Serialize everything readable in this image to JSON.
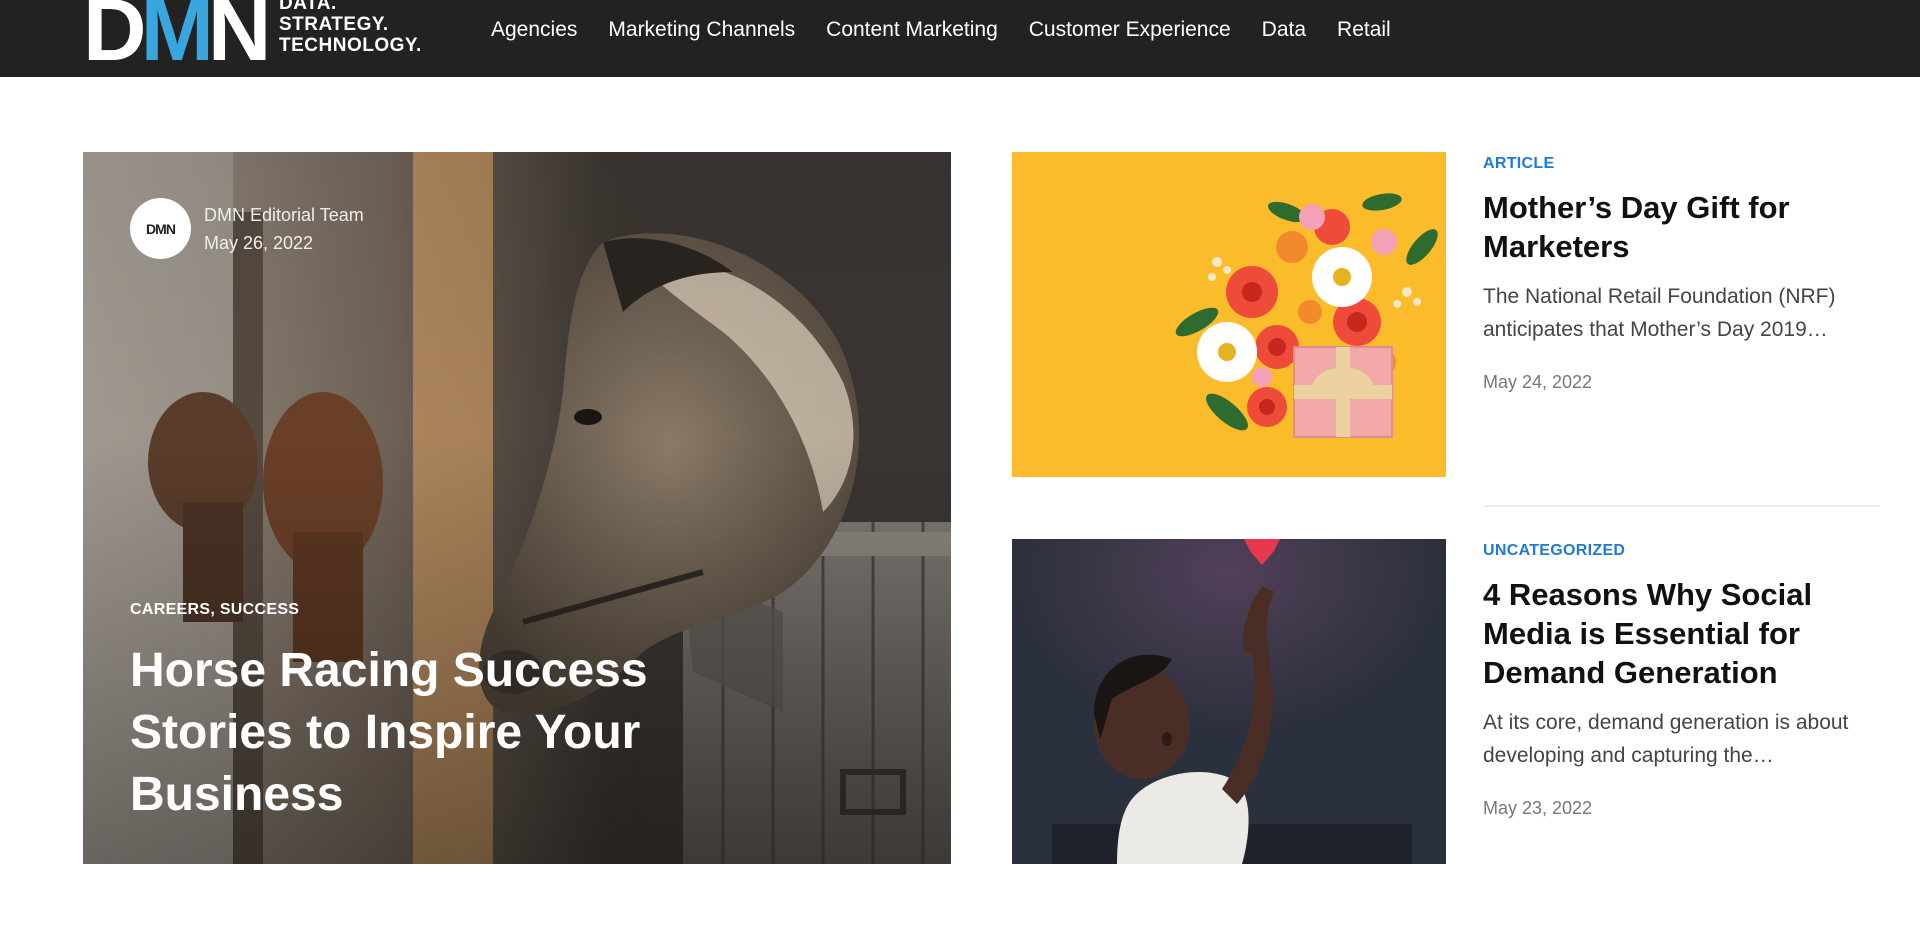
{
  "header": {
    "logo": {
      "letters": [
        "D",
        "M",
        "N"
      ],
      "tagline": [
        "DATA.",
        "STRATEGY.",
        "TECHNOLOGY."
      ]
    },
    "nav": [
      "Agencies",
      "Marketing Channels",
      "Content Marketing",
      "Customer Experience",
      "Data",
      "Retail"
    ]
  },
  "featured": {
    "author": "DMN Editorial Team",
    "date": "May 26, 2022",
    "avatar_text": "DMN",
    "categories": "CAREERS, SUCCESS",
    "title": "Horse Racing Success Stories to Inspire Your Business"
  },
  "posts": [
    {
      "category": "ARTICLE",
      "title": "Mother’s Day Gift for Marketers",
      "excerpt": "The National Retail Foundation (NRF) anticipates that Mother’s Day 2019…",
      "date": "May 24, 2022"
    },
    {
      "category": "UNCATEGORIZED",
      "title": "4 Reasons Why Social Media is Essential for Demand Generation",
      "excerpt": "At its core, demand generation is about developing and capturing the…",
      "date": "May 23, 2022"
    }
  ],
  "colors": {
    "topbar": "#222222",
    "accent": "#1f7ad6",
    "logo_m": "#3aa6e0",
    "flowers_bg": "#fbbc2c"
  }
}
